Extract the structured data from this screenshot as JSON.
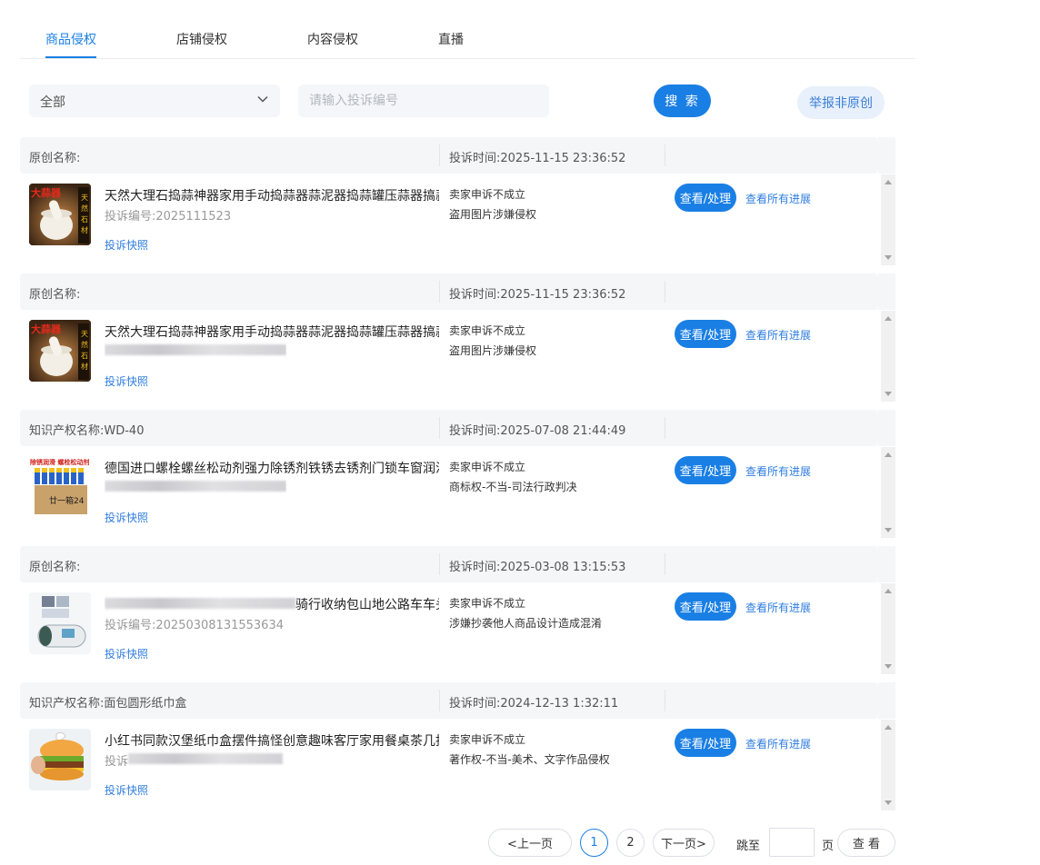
{
  "tabs": [
    {
      "label": "商品侵权",
      "active": true
    },
    {
      "label": "店铺侵权",
      "active": false
    },
    {
      "label": "内容侵权",
      "active": false
    },
    {
      "label": "直播",
      "active": false
    }
  ],
  "filter": {
    "select_value": "全部",
    "search_placeholder": "请输入投诉编号",
    "search_button": "搜 索",
    "report_button": "举报非原创"
  },
  "complaints": [
    {
      "name_label": "原创名称:",
      "time": "投诉时间:2025-11-15 23:36:52",
      "title": "天然大理石捣蒜神器家用手动捣蒜器蒜泥器捣蒜罐压蒜器搞蒜",
      "complaint_id": "投诉编号:2025111523",
      "snapshot": "投诉快照",
      "status": "卖家申诉不成立",
      "reason": "盗用图片涉嫌侵权",
      "action": "查看/处理",
      "progress": "查看所有进展",
      "thumb_text": "大蒜器"
    },
    {
      "name_label": "原创名称:",
      "time": "投诉时间:2025-11-15 23:36:52",
      "title": "天然大理石捣蒜神器家用手动捣蒜器蒜泥器捣蒜罐压蒜器搞蒜",
      "complaint_id": "",
      "snapshot": "投诉快照",
      "status": "卖家申诉不成立",
      "reason": "盗用图片涉嫌侵权",
      "action": "查看/处理",
      "progress": "查看所有进展",
      "thumb_text": "大蒜器"
    },
    {
      "name_label": "知识产权名称:WD-40",
      "time": "投诉时间:2025-07-08 21:44:49",
      "title": "德国进口螺栓螺丝松动剂强力除锈剂铁锈去锈剂门锁车窗润滑",
      "complaint_id": "",
      "snapshot": "投诉快照",
      "status": "卖家申诉不成立",
      "reason": "商标权-不当-司法行政判决",
      "action": "查看/处理",
      "progress": "查看所有进展",
      "thumb_text": "除锈润滑 螺栓松动剂"
    },
    {
      "name_label": "原创名称:",
      "time": "投诉时间:2025-03-08 13:15:53",
      "title": "骑行收纳包山地公路车车头",
      "complaint_id": "投诉编号:20250308131553634",
      "snapshot": "投诉快照",
      "status": "卖家申诉不成立",
      "reason": "涉嫌抄袭他人商品设计造成混淆",
      "action": "查看/处理",
      "progress": "查看所有进展",
      "thumb_text": ""
    },
    {
      "name_label": "知识产权名称:面包圆形纸巾盒",
      "time": "投诉时间:2024-12-13 1:32:11",
      "title": "小红书同款汉堡纸巾盒摆件搞怪创意趣味客厅家用餐桌茶几抽",
      "complaint_id": "投诉",
      "snapshot": "投诉快照",
      "status": "卖家申诉不成立",
      "reason": "著作权-不当-美术、文字作品侵权",
      "action": "查看/处理",
      "progress": "查看所有进展",
      "thumb_text": ""
    }
  ],
  "pagination": {
    "prev": "<上一页",
    "pages": [
      "1",
      "2"
    ],
    "current": "1",
    "next": "下一页>",
    "jump_label": "跳至",
    "page_unit": "页",
    "go_button": "查 看"
  },
  "colors": {
    "accent": "#1a7fe4",
    "link": "#2f7de1",
    "header_bg": "#f5f6f8"
  }
}
